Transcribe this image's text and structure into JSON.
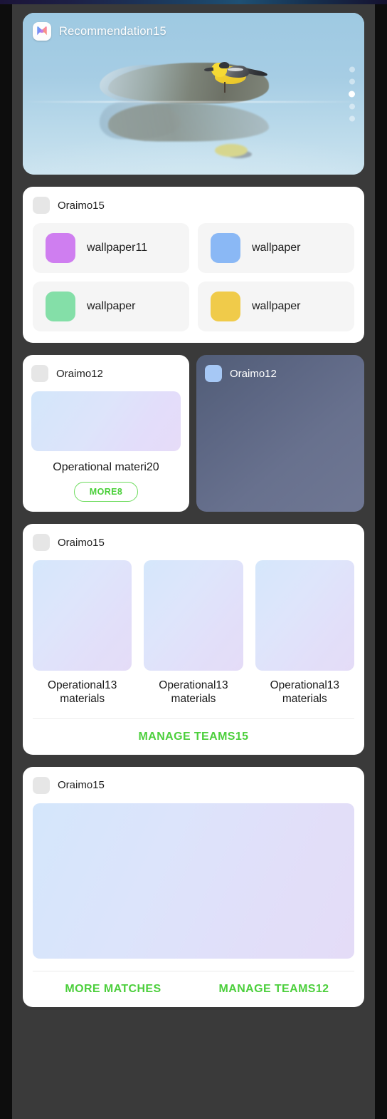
{
  "app": {
    "background_color": "#3a3a3a",
    "accent_green": "#4ccf3c"
  },
  "hero": {
    "app_icon_name": "recommendation-app-icon",
    "title": "Recommendation15",
    "image_alt": "yellow wagtail bird perched on a rock reflected in calm blue water",
    "pager": {
      "total": 5,
      "active_index": 2
    }
  },
  "wallpaper_card": {
    "icon_name": "placeholder-icon",
    "title": "Oraimo15",
    "items": [
      {
        "label": "wallpaper11",
        "color": "#cf7ef0"
      },
      {
        "label": "wallpaper",
        "color": "#8ab8f5"
      },
      {
        "label": "wallpaper",
        "color": "#84dfa8"
      },
      {
        "label": "wallpaper",
        "color": "#f0cb4a"
      }
    ]
  },
  "duo_row": {
    "left": {
      "icon_name": "placeholder-icon",
      "title": "Oraimo12",
      "caption": "Operational materi20",
      "button_label": "MORE8",
      "button_color": "#4ccf3c"
    },
    "right": {
      "icon_name": "placeholder-icon-blue",
      "title": "Oraimo12",
      "icon_color": "#a6c8f5",
      "background": "#5c6683"
    }
  },
  "teams_card": {
    "icon_name": "placeholder-icon",
    "title": "Oraimo15",
    "tiles": [
      {
        "caption": "Operational13 materials"
      },
      {
        "caption": "Operational13 materials"
      },
      {
        "caption": "Operational13 materials"
      }
    ],
    "action_label": "MANAGE TEAMS15"
  },
  "matches_card": {
    "icon_name": "placeholder-icon",
    "title": "Oraimo15",
    "actions": [
      {
        "label": "MORE MATCHES"
      },
      {
        "label": "MANAGE TEAMS12"
      }
    ]
  }
}
